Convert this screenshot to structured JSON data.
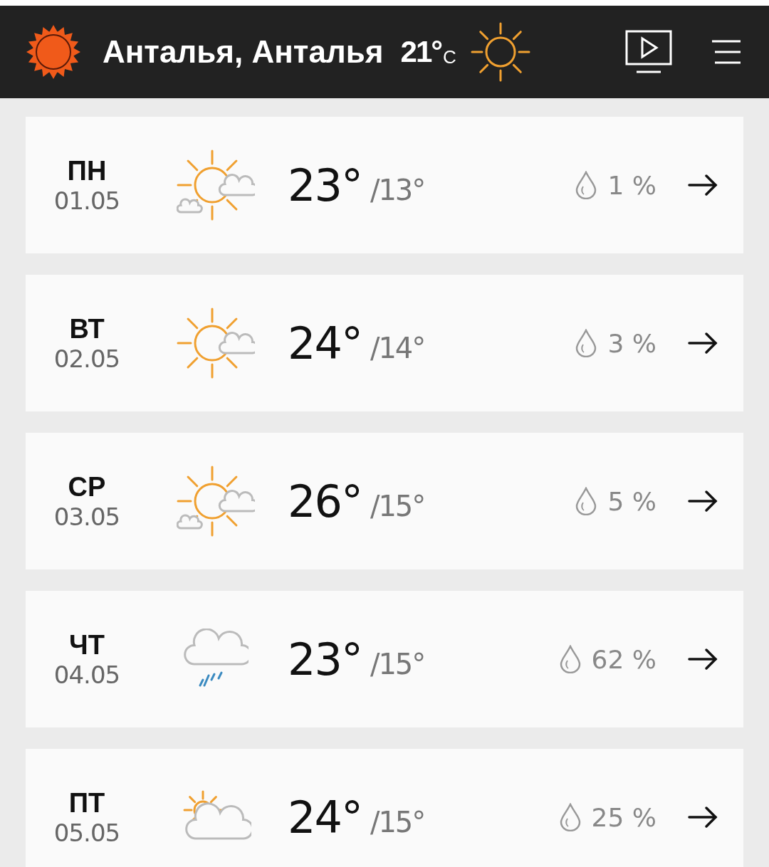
{
  "header": {
    "city": "Анталья, Анталья",
    "temperature": "21°",
    "unit": "C"
  },
  "days": [
    {
      "day": "ПН",
      "date": "01.05",
      "kind": "sun_clouds",
      "high": "23°",
      "low": "/13°",
      "precipitation": "1 %"
    },
    {
      "day": "ВТ",
      "date": "02.05",
      "kind": "sun_cloud",
      "high": "24°",
      "low": "/14°",
      "precipitation": "3 %"
    },
    {
      "day": "СР",
      "date": "03.05",
      "kind": "sun_clouds",
      "high": "26°",
      "low": "/15°",
      "precipitation": "5 %"
    },
    {
      "day": "ЧТ",
      "date": "04.05",
      "kind": "rain",
      "high": "23°",
      "low": "/15°",
      "precipitation": "62 %"
    },
    {
      "day": "ПТ",
      "date": "05.05",
      "kind": "cloud_sun",
      "high": "24°",
      "low": "/15°",
      "precipitation": "25 %"
    }
  ]
}
